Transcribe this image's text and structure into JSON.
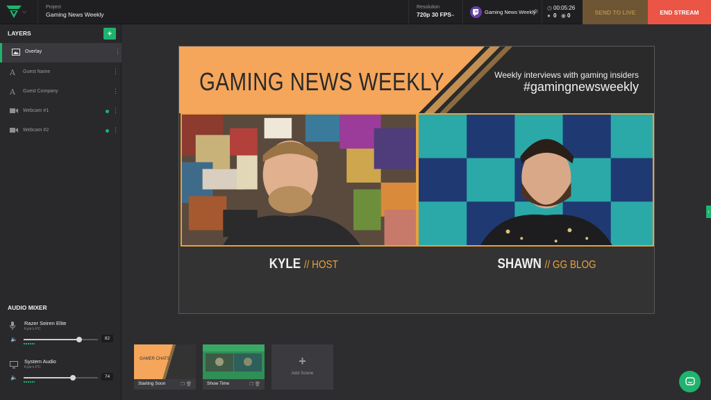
{
  "topbar": {
    "project_label": "Project",
    "project_name": "Gaming News Weekly",
    "resolution_label": "Resolution",
    "resolution_value": "720p 30 FPS",
    "channel_name": "Gaming News Weekly",
    "stream_timer": "00:05:26",
    "chat_count": "0",
    "viewer_count": "0",
    "send_to_live": "SEND TO LIVE",
    "end_stream": "END STREAM"
  },
  "sidebar": {
    "layers_title": "LAYERS",
    "layers": [
      {
        "label": "Overlay",
        "icon": "image-icon",
        "active": true
      },
      {
        "label": "Guest Name",
        "icon": "text-icon"
      },
      {
        "label": "Guest Company",
        "icon": "text-icon"
      },
      {
        "label": "Webcam #1",
        "icon": "camera-icon",
        "live": true
      },
      {
        "label": "Webcam #2",
        "icon": "camera-icon",
        "live": true
      }
    ],
    "mixer_title": "AUDIO MIXER",
    "sources": [
      {
        "name": "Razer Seiren Elite",
        "sub": "Kyle's PC",
        "volume": "82"
      },
      {
        "name": "System Audio",
        "sub": "Kyle's PC",
        "volume": "74"
      }
    ]
  },
  "canvas": {
    "title": "GAMING NEWS WEEKLY",
    "tagline": "Weekly interviews with gaming insiders",
    "hashtag": "#gamingnewsweekly",
    "host_name": "KYLE",
    "host_role": "// HOST",
    "guest_name": "SHAWN",
    "guest_role": "// GG BLOG"
  },
  "scenes": [
    {
      "label": "Starting Soon",
      "thumb_text": "GAMER CHATS"
    },
    {
      "label": "Show Time"
    }
  ],
  "add_scene_label": "Add Scene",
  "colors": {
    "accent_green": "#1fb36e",
    "end_stream_red": "#eb5545",
    "send_live_brown": "#6e5533",
    "overlay_orange": "#f5a65b",
    "twitch_purple": "#6441a5"
  }
}
